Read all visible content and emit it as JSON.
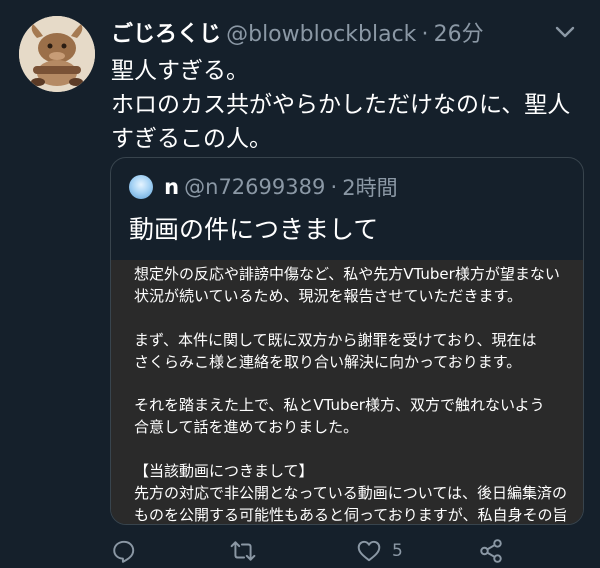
{
  "tweet": {
    "author_name": "ごじろくじ",
    "author_handle": "@blowblockblack",
    "separator": "·",
    "time": "26分",
    "text": "聖人すぎる。\nホロのカス共がやらかしただけなのに、聖人すぎるこの人。"
  },
  "quote": {
    "author_name": "n",
    "author_handle": "@n72699389",
    "separator": "·",
    "time": "2時間",
    "text": "動画の件につきまして",
    "image_text": "想定外の反応や誹謗中傷など、私や先方VTuber様方が望まない\n状況が続いているため、現況を報告させていただきます。\n\nまず、本件に関して既に双方から謝罪を受けており、現在は\nさくらみこ様と連絡を取り合い解決に向かっております。\n\nそれを踏まえた上で、私とVTuber様方、双方で触れないよう\n合意して話を進めておりました。\n\n【当該動画につきまして】\n先方の対応で非公開となっている動画については、後日編集済の\nものを公開する可能性もあると伺っておりますが、私自身その旨\nを了承しております。"
  },
  "actions": {
    "like_count": "5"
  },
  "colors": {
    "background": "#15202b",
    "secondary_text": "#8b98a5",
    "border": "#38444d"
  },
  "icons": [
    "more-icon",
    "reply-icon",
    "retweet-icon",
    "like-icon",
    "share-icon"
  ]
}
